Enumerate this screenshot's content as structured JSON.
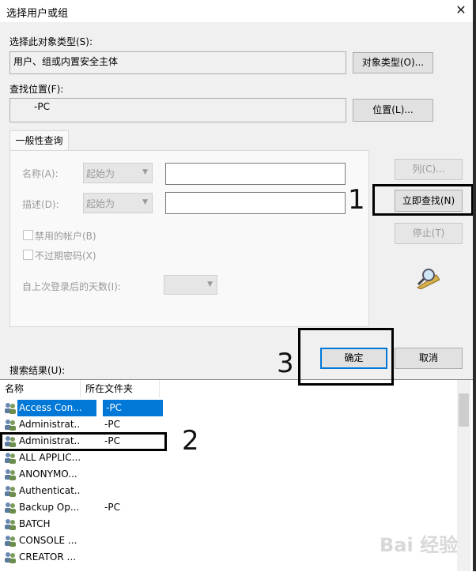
{
  "window": {
    "title": "选择用户或组",
    "close_glyph": "✕"
  },
  "object_type": {
    "label": "选择此对象类型(S):",
    "value": "用户、组或内置安全主体",
    "button": "对象类型(O)..."
  },
  "location": {
    "label": "查找位置(F):",
    "value": "-PC",
    "button": "位置(L)..."
  },
  "tab": {
    "label": "一般性查询"
  },
  "query": {
    "name_label": "名称(A):",
    "name_mode": "起始为",
    "desc_label": "描述(D):",
    "desc_mode": "起始为",
    "disabled_accounts": "禁用的帐户(B)",
    "no_expire_pwd": "不过期密码(X)",
    "days_label": "自上次登录后的天数(I):"
  },
  "buttons": {
    "columns": "列(C)...",
    "find_now": "立即查找(N)",
    "stop": "停止(T)",
    "ok": "确定",
    "cancel": "取消"
  },
  "results": {
    "label": "搜索结果(U):",
    "headers": [
      "名称",
      "所在文件夹"
    ],
    "rows": [
      {
        "name": "Access Con...",
        "folder": "-PC"
      },
      {
        "name": "Administrat...",
        "folder": "-PC"
      },
      {
        "name": "Administrat...",
        "folder": "-PC"
      },
      {
        "name": "ALL APPLIC...",
        "folder": ""
      },
      {
        "name": "ANONYMO...",
        "folder": ""
      },
      {
        "name": "Authenticat...",
        "folder": ""
      },
      {
        "name": "Backup Op...",
        "folder": "-PC"
      },
      {
        "name": "BATCH",
        "folder": ""
      },
      {
        "name": "CONSOLE ...",
        "folder": ""
      },
      {
        "name": "CREATOR ...",
        "folder": ""
      }
    ]
  },
  "annotations": {
    "n1": "1",
    "n2": "2",
    "n3": "3"
  },
  "watermark": "Bai 经验",
  "colors": {
    "selection": "#0078d7",
    "default_button_border": "#0078d7"
  }
}
